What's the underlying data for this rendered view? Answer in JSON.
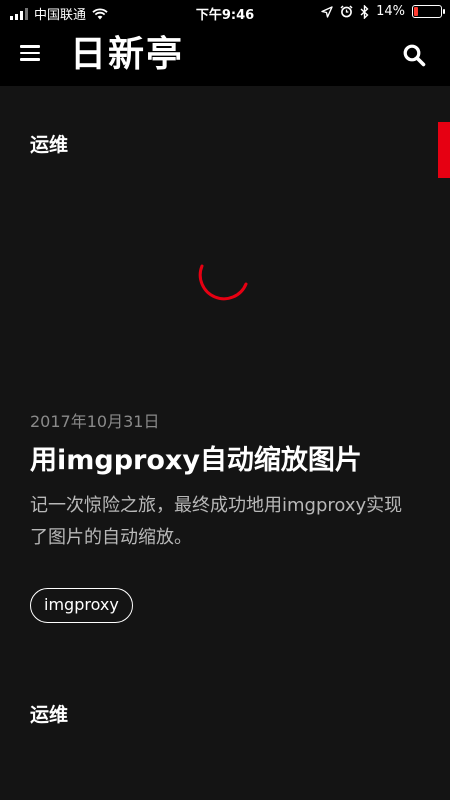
{
  "status_bar": {
    "carrier": "中国联通",
    "time": "下午9:46",
    "battery": "14%",
    "battery_level": 0.14,
    "battery_color": "#ff3b30"
  },
  "header": {
    "title": "日新亭",
    "menu_icon": "hamburger-menu-icon",
    "search_icon": "search-icon"
  },
  "side_badge": {
    "color": "#e60012"
  },
  "sections": [
    {
      "category": "运维",
      "post": {
        "date": "2017年10月31日",
        "title": "用imgproxy自动缩放图片",
        "excerpt": "记一次惊险之旅，最终成功地用imgproxy实现了图片的自动缩放。",
        "tags": [
          "imgproxy"
        ]
      }
    },
    {
      "category": "运维"
    }
  ],
  "loading_spinner": {
    "color": "#e60012"
  }
}
